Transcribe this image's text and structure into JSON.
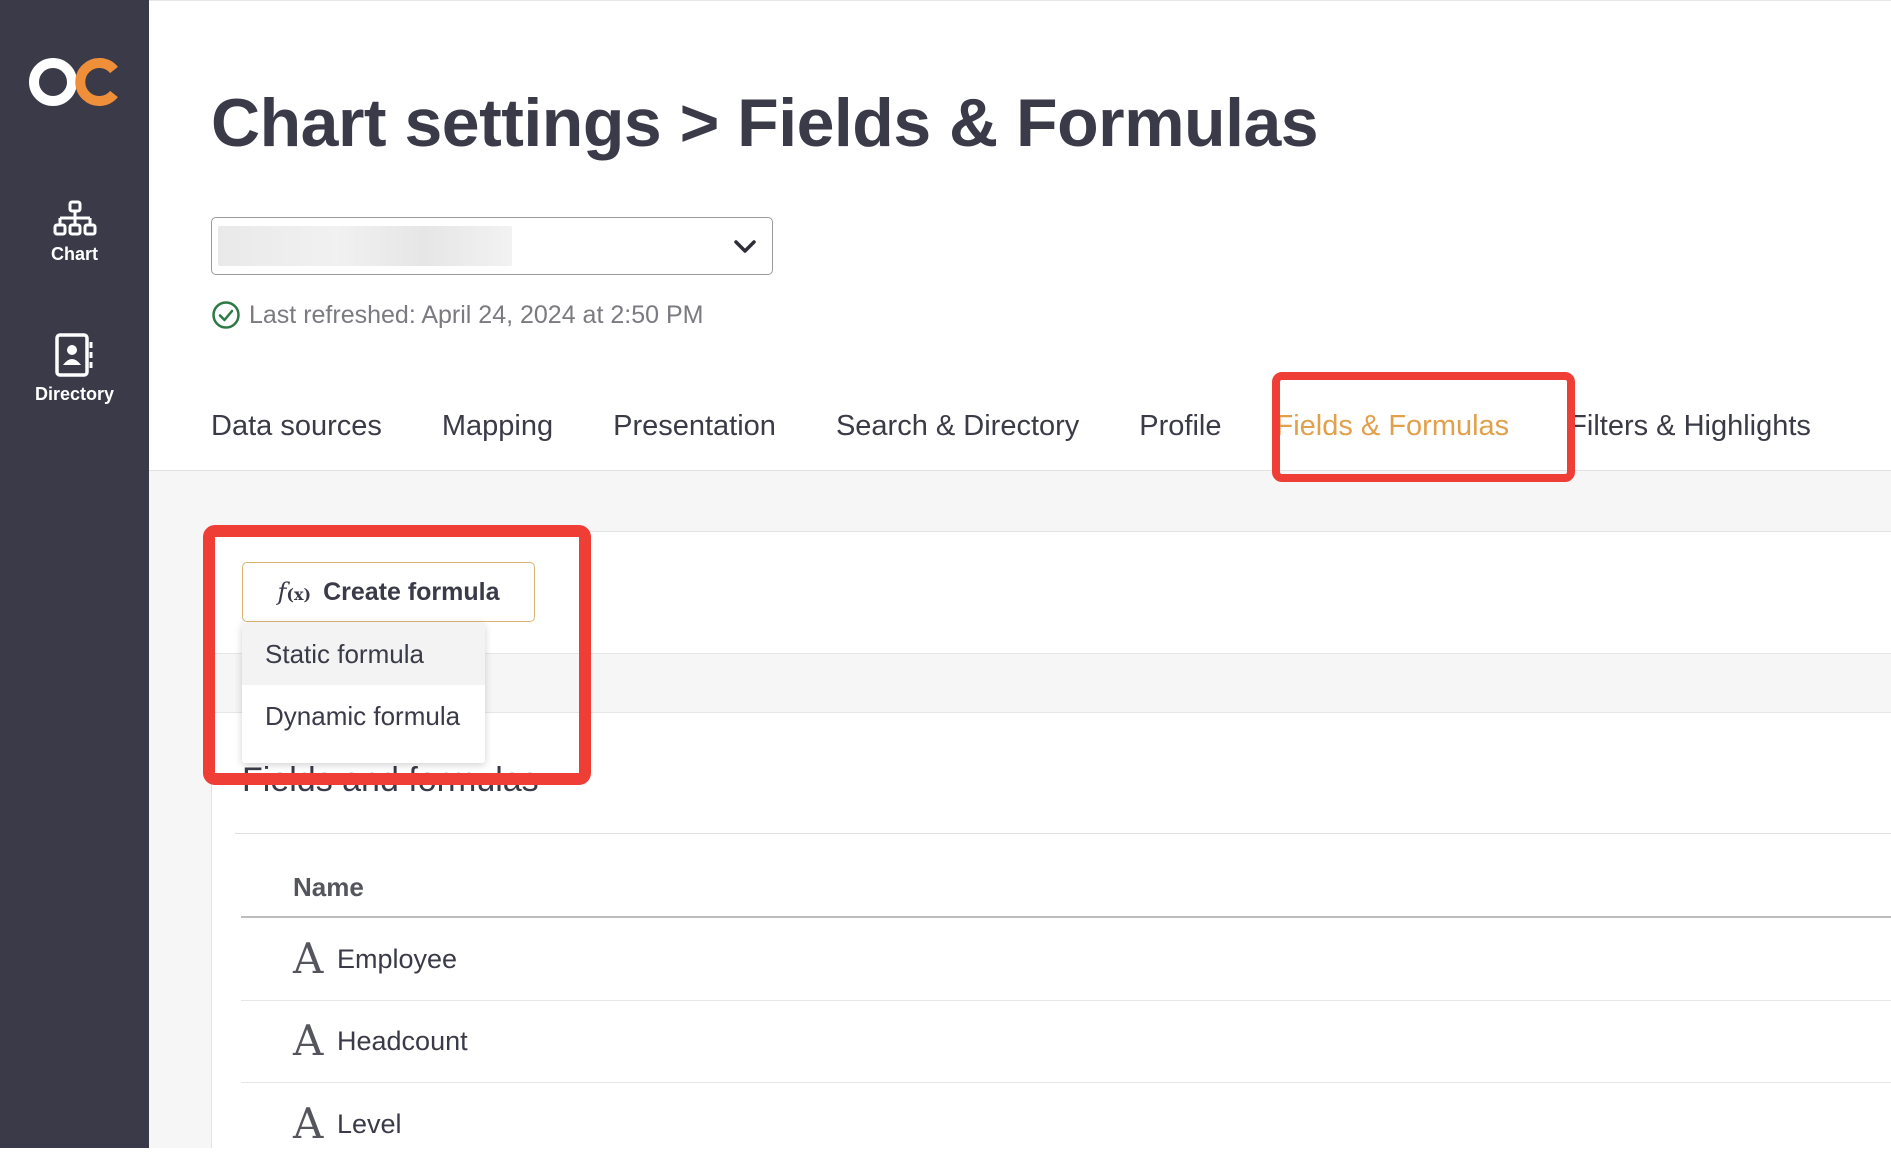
{
  "sidebar": {
    "logo": "OC",
    "items": [
      {
        "label": "Chart",
        "icon": "org-chart-icon"
      },
      {
        "label": "Directory",
        "icon": "directory-icon"
      }
    ]
  },
  "header": {
    "title": "Chart settings > Fields & Formulas",
    "refresh_status": "Last refreshed: April 24, 2024 at 2:50 PM"
  },
  "tabs": [
    {
      "label": "Data sources"
    },
    {
      "label": "Mapping"
    },
    {
      "label": "Presentation"
    },
    {
      "label": "Search & Directory"
    },
    {
      "label": "Profile"
    },
    {
      "label": "Fields & Formulas",
      "active": true
    },
    {
      "label": "Filters & Highlights"
    }
  ],
  "toolbar": {
    "create_label": "Create formula",
    "create_icon_text": "f",
    "create_icon_sub": "(x)",
    "menu": [
      "Static formula",
      "Dynamic formula"
    ]
  },
  "section": {
    "title": "Fields and formulas"
  },
  "table": {
    "columns": [
      "Name"
    ],
    "rows": [
      {
        "type_icon": "A",
        "name": "Employee"
      },
      {
        "type_icon": "A",
        "name": "Headcount"
      },
      {
        "type_icon": "A",
        "name": "Level"
      }
    ]
  },
  "colors": {
    "sidebar": "#3a3a48",
    "accent": "#e0a04c",
    "logo_orange": "#ef8f3a",
    "highlight": "#ef3e36"
  }
}
